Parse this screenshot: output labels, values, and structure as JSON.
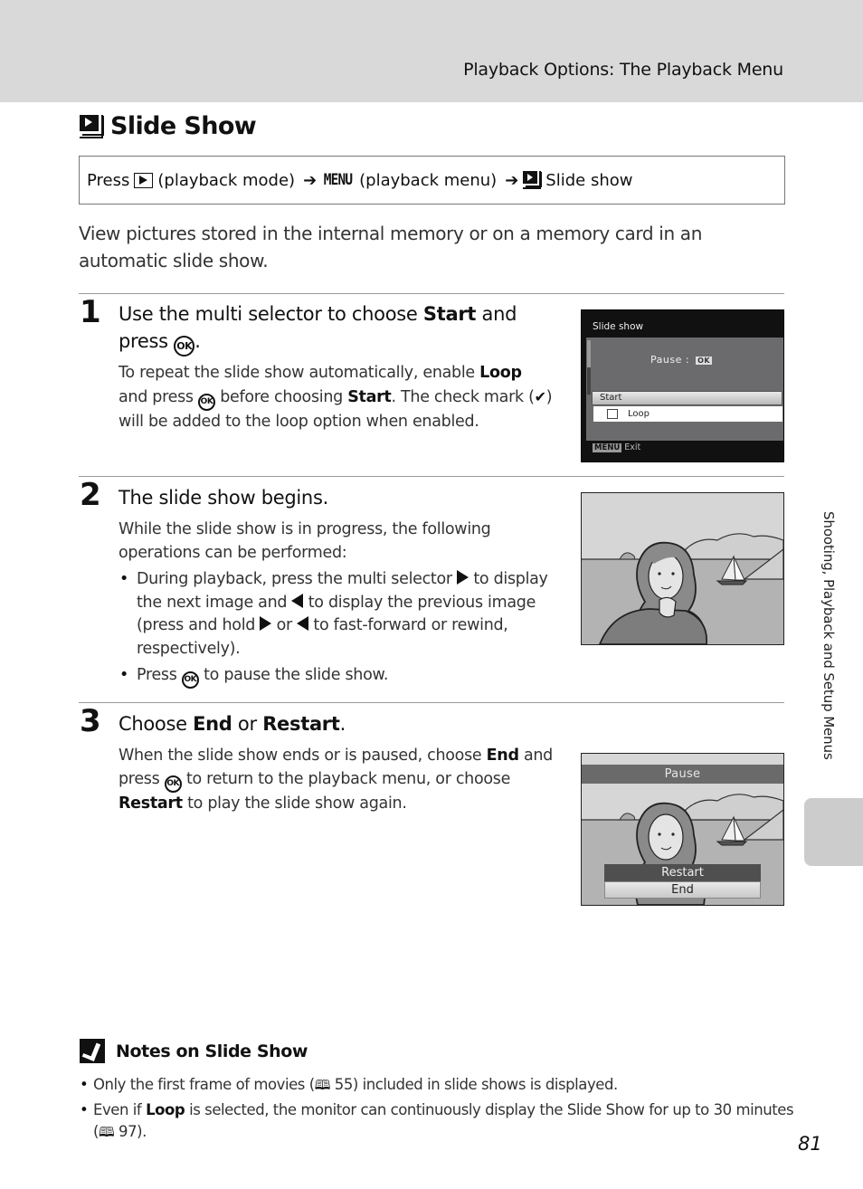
{
  "header": {
    "section_title": "Playback Options: The Playback Menu"
  },
  "side_tab": {
    "label": "Shooting, Playback and Setup Menus"
  },
  "page": {
    "title_icon": "slide-show-icon",
    "title": "Slide Show",
    "page_number": "81"
  },
  "press_path": {
    "press": "Press",
    "playback_mode": "(playback mode)",
    "menu_glyph": "MENU",
    "playback_menu": "(playback menu)",
    "slide_show": "Slide show",
    "arrow": "➔"
  },
  "intro": "View pictures stored in the internal memory or on a memory card in an automatic slide show.",
  "glyphs": {
    "ok": "OK",
    "check": "✔",
    "book": "🕮"
  },
  "steps": [
    {
      "number": "1",
      "head_pre": "Use the multi selector to choose ",
      "head_bold": "Start",
      "head_mid": " and press ",
      "head_post": ".",
      "body": {
        "p1": "To repeat the slide show automatically, enable ",
        "b1": "Loop",
        "p2": " and press ",
        "p3": " before choosing ",
        "b2": "Start",
        "p4": ". The check mark (",
        "p5": ") will be added to the loop option when enabled."
      }
    },
    {
      "number": "2",
      "head": "The slide show begins.",
      "body": "While the slide show is in progress, the following operations can be performed:",
      "bullet1": {
        "p1": "During playback, press the multi selector ",
        "p2": " to display the next image and ",
        "p3": " to display the previous image (press and hold ",
        "p4": " or ",
        "p5": " to fast-forward or rewind, respectively)."
      },
      "bullet2": {
        "p1": "Press ",
        "p2": " to pause the slide show."
      }
    },
    {
      "number": "3",
      "head_pre": "Choose ",
      "head_b1": "End",
      "head_mid": " or ",
      "head_b2": "Restart",
      "head_post": ".",
      "body": {
        "p1": "When the slide show ends or is paused, choose ",
        "b1": "End",
        "p2": " and press ",
        "p3": " to return to the playback menu, or choose ",
        "b2": "Restart",
        "p4": " to play the slide show again."
      }
    }
  ],
  "screen1": {
    "title": "Slide show",
    "pause_label": "Pause",
    "pause_key": "OK",
    "menu_items": [
      "Start",
      "Loop"
    ],
    "loop_checked": false,
    "footer_key": "MENU",
    "footer_label": "Exit"
  },
  "screen3": {
    "banner": "Pause",
    "options": [
      "Restart",
      "End"
    ]
  },
  "notes": {
    "title": "Notes on Slide Show",
    "items": [
      {
        "pre": "Only the first frame of movies (",
        "ref": "55",
        "post": ") included in slide shows is displayed."
      },
      {
        "pre": "Even if ",
        "bold": "Loop",
        "mid": " is selected, the monitor can continuously display the Slide Show for up to 30 minutes (",
        "ref": "97",
        "post": ")."
      }
    ]
  }
}
